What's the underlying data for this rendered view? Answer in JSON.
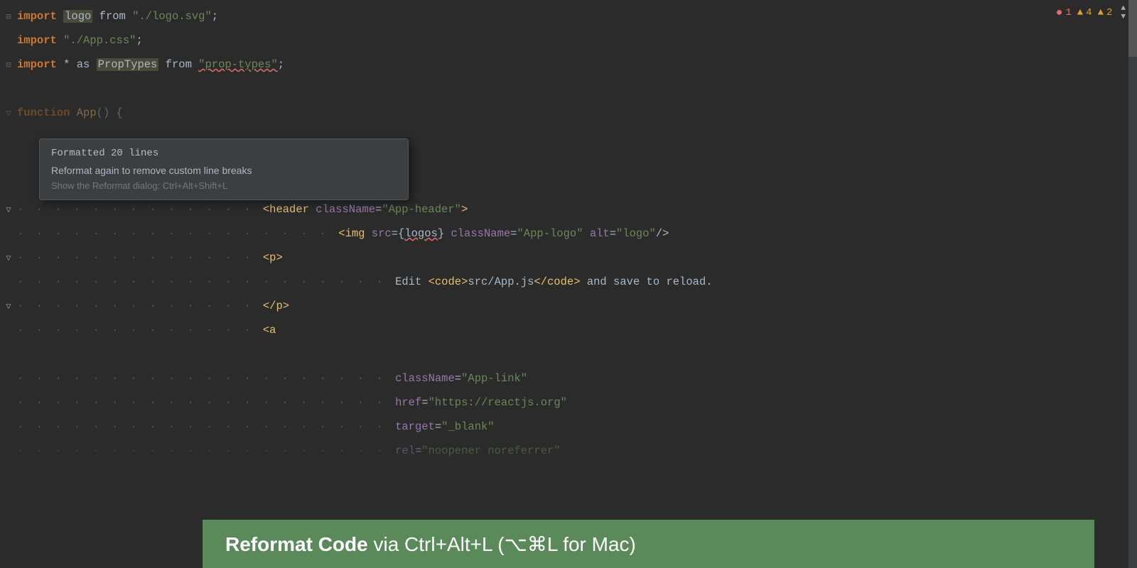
{
  "editor": {
    "background": "#2b2b2b",
    "lines": [
      {
        "id": "line1",
        "fold": "⊟",
        "parts": [
          {
            "text": "import ",
            "class": "kw"
          },
          {
            "text": "logo",
            "class": "logo-hl"
          },
          {
            "text": " from ",
            "class": "id"
          },
          {
            "text": "\"./logo.svg\"",
            "class": "str"
          },
          {
            "text": ";",
            "class": "id"
          }
        ]
      },
      {
        "id": "line2",
        "fold": "",
        "parts": [
          {
            "text": "import ",
            "class": "kw"
          },
          {
            "text": "\"./App.css\"",
            "class": "str"
          },
          {
            "text": ";",
            "class": "id"
          }
        ]
      },
      {
        "id": "line3",
        "fold": "⊟",
        "parts": [
          {
            "text": "import ",
            "class": "kw"
          },
          {
            "text": "* as ",
            "class": "id"
          },
          {
            "text": "PropTypes",
            "class": "proptypes-hl"
          },
          {
            "text": " from ",
            "class": "id"
          },
          {
            "text": "\"prop-types\"",
            "class": "str squiggle"
          },
          {
            "text": ";",
            "class": "id"
          }
        ]
      }
    ],
    "code_lines_after": [
      "line5_empty",
      "line6_function",
      "line7_empty",
      "line8_header",
      "line9_img",
      "line10_p_open",
      "line11_edit",
      "line12_p_close",
      "line13_a_open",
      "line14_empty2",
      "line15_classname",
      "line16_href",
      "line17_target"
    ]
  },
  "topbar": {
    "error_icon": "●",
    "error_count": "1",
    "warning_icon": "▲",
    "warning_count1": "4",
    "warning_count2": "2"
  },
  "tooltip": {
    "line1": "Formatted 20 lines",
    "line2": "Reformat again to remove custom line breaks",
    "line3": "Show the Reformat dialog: Ctrl+Alt+Shift+L"
  },
  "notification": {
    "bold_text": "Reformat Code",
    "normal_text": " via Ctrl+Alt+L (⌥⌘L for Mac)"
  }
}
